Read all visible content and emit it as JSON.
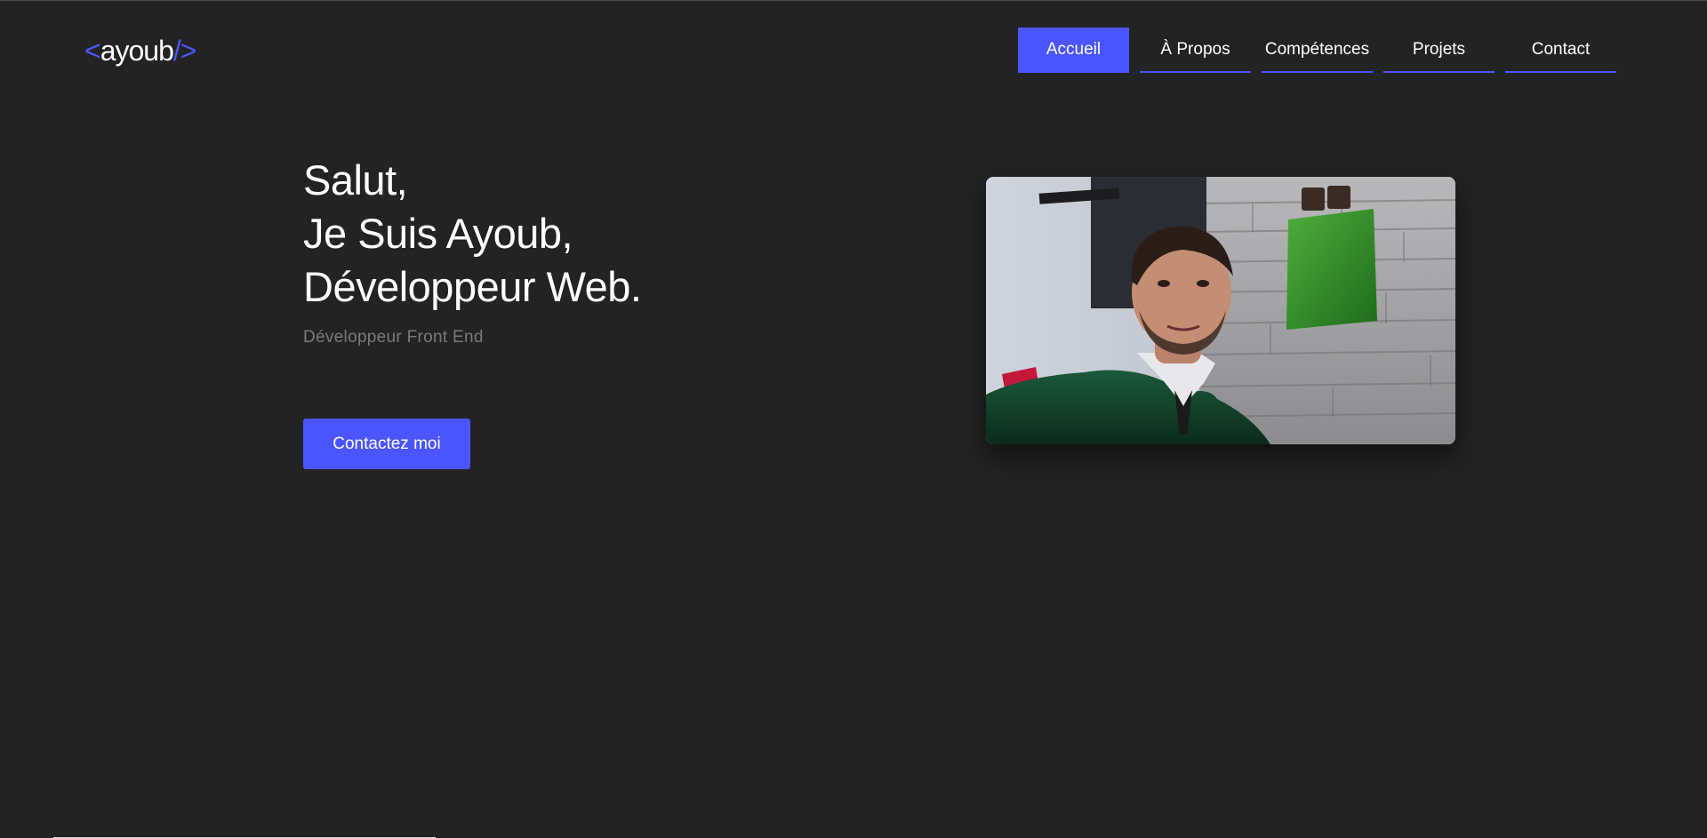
{
  "logo": {
    "open_bracket": "<",
    "name": "ayoub",
    "close_bracket": "/>"
  },
  "nav": {
    "items": [
      {
        "label": "Accueil",
        "active": true
      },
      {
        "label": "À Propos",
        "active": false
      },
      {
        "label": "Compétences",
        "active": false
      },
      {
        "label": "Projets",
        "active": false
      },
      {
        "label": "Contact",
        "active": false
      }
    ]
  },
  "hero": {
    "line1": "Salut,",
    "line2": "Je Suis Ayoub,",
    "line3": "Développeur Web.",
    "subtitle": "Développeur Front End",
    "cta_label": "Contactez moi"
  },
  "colors": {
    "background": "#232323",
    "accent": "#4b55ff",
    "text": "#ffffff",
    "muted": "#7a7a7a"
  }
}
